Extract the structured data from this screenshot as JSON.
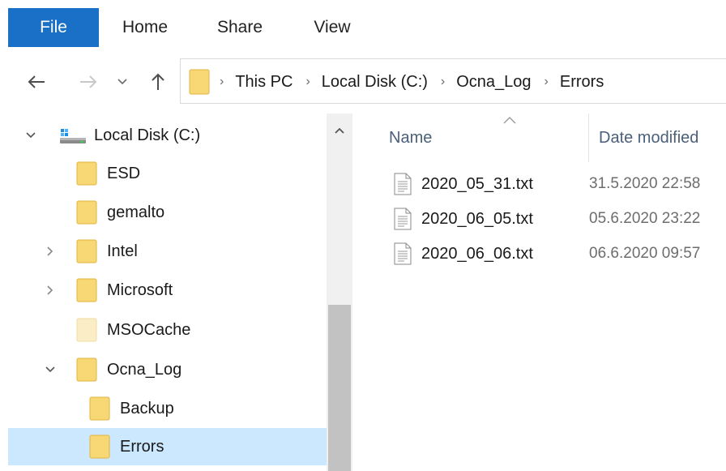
{
  "ribbon": {
    "tabs": [
      "File",
      "Home",
      "Share",
      "View"
    ]
  },
  "nav": {
    "back_icon": "arrow-left-icon",
    "forward_icon": "arrow-right-icon",
    "recent_icon": "chevron-down-icon",
    "up_icon": "arrow-up-icon"
  },
  "address": {
    "crumbs": [
      "This PC",
      "Local Disk (C:)",
      "Ocna_Log",
      "Errors"
    ]
  },
  "tree": {
    "items": [
      {
        "label": "Local Disk (C:)",
        "expanded": true,
        "icon": "drive-icon"
      },
      {
        "label": "ESD"
      },
      {
        "label": "gemalto"
      },
      {
        "label": "Intel",
        "expandable": true
      },
      {
        "label": "Microsoft",
        "expandable": true
      },
      {
        "label": "MSOCache",
        "hidden_folder": true
      },
      {
        "label": "Ocna_Log",
        "expanded": true
      },
      {
        "label": "Backup"
      },
      {
        "label": "Errors",
        "selected": true
      }
    ]
  },
  "list": {
    "columns": {
      "name": "Name",
      "date": "Date modified"
    },
    "sort": "Name ascending",
    "files": [
      {
        "name": "2020_05_31.txt",
        "date": "31.5.2020 22:58"
      },
      {
        "name": "2020_06_05.txt",
        "date": "05.6.2020 23:22"
      },
      {
        "name": "2020_06_06.txt",
        "date": "06.6.2020 09:57"
      }
    ]
  },
  "colors": {
    "accent": "#1a6fc6",
    "selection": "#cce8ff",
    "folder": "#f8d775",
    "folder_dim": "#fbeec7"
  }
}
